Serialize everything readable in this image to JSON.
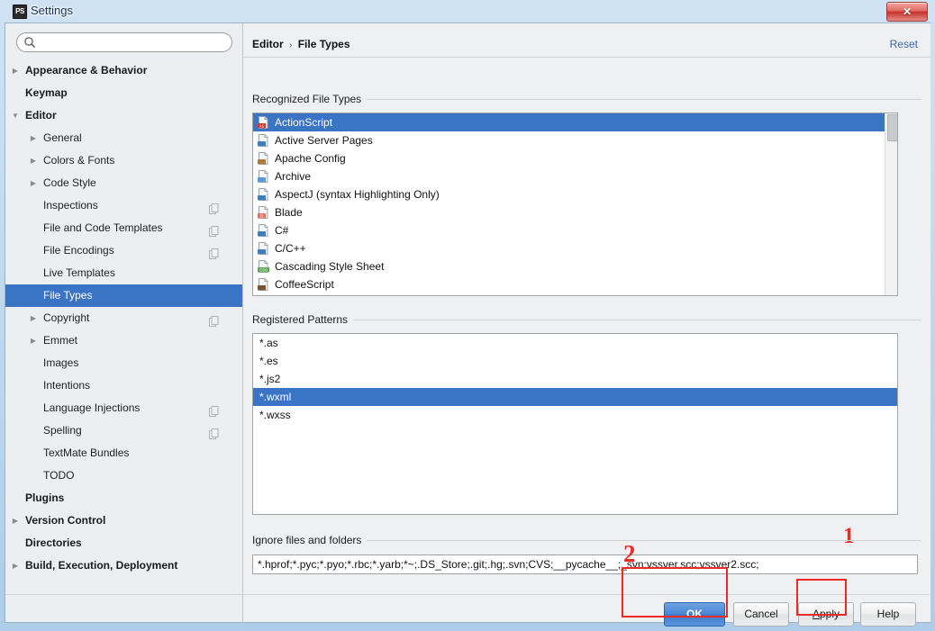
{
  "window": {
    "title": "Settings",
    "app_icon": "phpstorm-icon",
    "close_label": "✕"
  },
  "sidebar": {
    "search": {
      "value": "",
      "placeholder": "",
      "icon": "search-icon"
    },
    "items": [
      {
        "label": "Appearance & Behavior",
        "level": 0,
        "bold": true,
        "arrow": "collapsed",
        "copy": false,
        "selected": false
      },
      {
        "label": "Keymap",
        "level": 0,
        "bold": true,
        "arrow": "none",
        "copy": false,
        "selected": false
      },
      {
        "label": "Editor",
        "level": 0,
        "bold": true,
        "arrow": "expanded",
        "copy": false,
        "selected": false
      },
      {
        "label": "General",
        "level": 1,
        "bold": false,
        "arrow": "collapsed",
        "copy": false,
        "selected": false
      },
      {
        "label": "Colors & Fonts",
        "level": 1,
        "bold": false,
        "arrow": "collapsed",
        "copy": false,
        "selected": false
      },
      {
        "label": "Code Style",
        "level": 1,
        "bold": false,
        "arrow": "collapsed",
        "copy": false,
        "selected": false
      },
      {
        "label": "Inspections",
        "level": 1,
        "bold": false,
        "arrow": "none",
        "copy": true,
        "selected": false
      },
      {
        "label": "File and Code Templates",
        "level": 1,
        "bold": false,
        "arrow": "none",
        "copy": true,
        "selected": false
      },
      {
        "label": "File Encodings",
        "level": 1,
        "bold": false,
        "arrow": "none",
        "copy": true,
        "selected": false
      },
      {
        "label": "Live Templates",
        "level": 1,
        "bold": false,
        "arrow": "none",
        "copy": false,
        "selected": false
      },
      {
        "label": "File Types",
        "level": 1,
        "bold": false,
        "arrow": "none",
        "copy": false,
        "selected": true
      },
      {
        "label": "Copyright",
        "level": 1,
        "bold": false,
        "arrow": "collapsed",
        "copy": true,
        "selected": false
      },
      {
        "label": "Emmet",
        "level": 1,
        "bold": false,
        "arrow": "collapsed",
        "copy": false,
        "selected": false
      },
      {
        "label": "Images",
        "level": 1,
        "bold": false,
        "arrow": "none",
        "copy": false,
        "selected": false
      },
      {
        "label": "Intentions",
        "level": 1,
        "bold": false,
        "arrow": "none",
        "copy": false,
        "selected": false
      },
      {
        "label": "Language Injections",
        "level": 1,
        "bold": false,
        "arrow": "none",
        "copy": true,
        "selected": false
      },
      {
        "label": "Spelling",
        "level": 1,
        "bold": false,
        "arrow": "none",
        "copy": true,
        "selected": false
      },
      {
        "label": "TextMate Bundles",
        "level": 1,
        "bold": false,
        "arrow": "none",
        "copy": false,
        "selected": false
      },
      {
        "label": "TODO",
        "level": 1,
        "bold": false,
        "arrow": "none",
        "copy": false,
        "selected": false
      },
      {
        "label": "Plugins",
        "level": 0,
        "bold": true,
        "arrow": "none",
        "copy": false,
        "selected": false
      },
      {
        "label": "Version Control",
        "level": 0,
        "bold": true,
        "arrow": "collapsed",
        "copy": false,
        "selected": false
      },
      {
        "label": "Directories",
        "level": 0,
        "bold": true,
        "arrow": "none",
        "copy": false,
        "selected": false
      },
      {
        "label": "Build, Execution, Deployment",
        "level": 0,
        "bold": true,
        "arrow": "collapsed",
        "copy": false,
        "selected": false
      }
    ]
  },
  "content": {
    "breadcrumb": {
      "root": "Editor",
      "separator": "›",
      "leaf": "File Types"
    },
    "reset_label": "Reset",
    "recognized": {
      "group_label": "Recognized File Types",
      "items": [
        {
          "label": "ActionScript",
          "icon": "actionscript-file-icon",
          "selected": true
        },
        {
          "label": "Active Server Pages",
          "icon": "asp-file-icon",
          "selected": false
        },
        {
          "label": "Apache Config",
          "icon": "apache-config-file-icon",
          "selected": false
        },
        {
          "label": "Archive",
          "icon": "archive-file-icon",
          "selected": false
        },
        {
          "label": "AspectJ (syntax Highlighting Only)",
          "icon": "aspectj-file-icon",
          "selected": false
        },
        {
          "label": "Blade",
          "icon": "blade-file-icon",
          "selected": false
        },
        {
          "label": "C#",
          "icon": "csharp-file-icon",
          "selected": false
        },
        {
          "label": "C/C++",
          "icon": "cpp-file-icon",
          "selected": false
        },
        {
          "label": "Cascading Style Sheet",
          "icon": "css-file-icon",
          "selected": false
        },
        {
          "label": "CoffeeScript",
          "icon": "coffeescript-file-icon",
          "selected": false
        }
      ],
      "toolbar": [
        {
          "name": "add-file-type-button",
          "glyph": "+",
          "enabled": true
        },
        {
          "name": "remove-file-type-button",
          "glyph": "−",
          "enabled": false
        },
        {
          "name": "edit-file-type-button",
          "glyph": "✎",
          "enabled": false
        }
      ]
    },
    "patterns": {
      "group_label": "Registered Patterns",
      "items": [
        {
          "label": "*.as",
          "selected": false
        },
        {
          "label": "*.es",
          "selected": false
        },
        {
          "label": "*.js2",
          "selected": false
        },
        {
          "label": "*.wxml",
          "selected": true
        },
        {
          "label": "*.wxss",
          "selected": false
        }
      ],
      "toolbar": [
        {
          "name": "add-pattern-button",
          "glyph": "+",
          "enabled": true
        },
        {
          "name": "remove-pattern-button",
          "glyph": "−",
          "enabled": true
        },
        {
          "name": "edit-pattern-button",
          "glyph": "✎",
          "enabled": true
        }
      ]
    },
    "ignore": {
      "group_label": "Ignore files and folders",
      "value": "*.hprof;*.pyc;*.pyo;*.rbc;*.yarb;*~;.DS_Store;.git;.hg;.svn;CVS;__pycache__;_svn;vssver.scc;vssver2.scc;",
      "placeholder": ""
    }
  },
  "footer": {
    "ok": "OK",
    "cancel": "Cancel",
    "apply_underlined": "A",
    "apply_rest": "pply",
    "help": "Help"
  },
  "annotations": {
    "marker_one": "1",
    "marker_two": "2",
    "color": "#ee2a24"
  }
}
